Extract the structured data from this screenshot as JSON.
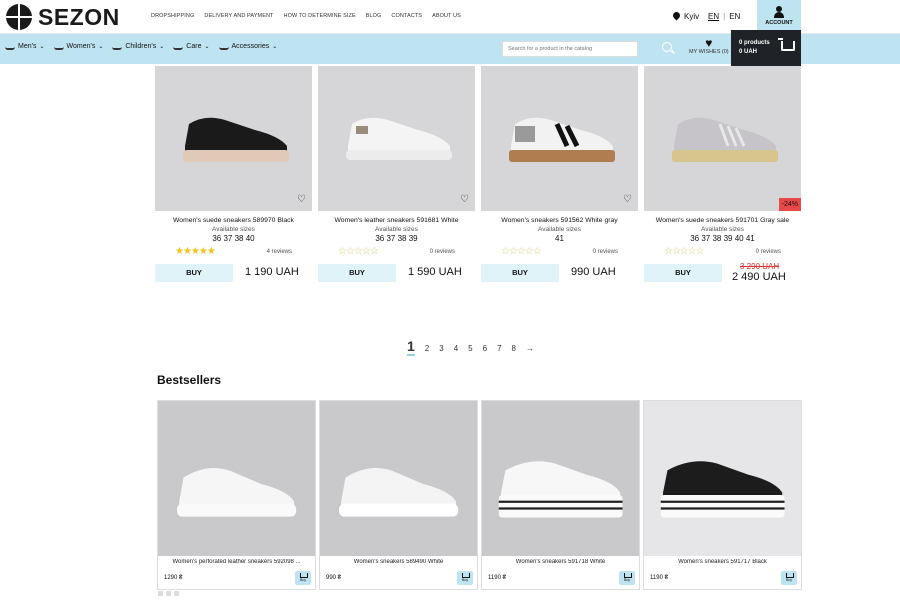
{
  "header": {
    "logo": "SEZON",
    "nav": [
      "DROPSHIPPING",
      "DELIVERY AND PAYMENT",
      "HOW TO DETERMINE SIZE",
      "BLOG",
      "CONTACTS",
      "ABOUT US"
    ],
    "city": "Kyiv",
    "lang_active": "EN",
    "lang_sep": "|",
    "lang_other": "EN",
    "account": "ACCOUNT"
  },
  "catbar": {
    "categories": [
      "Men's",
      "Women's",
      "Children's",
      "Care",
      "Accessories"
    ],
    "search_placeholder": "Search for a product in the catalog",
    "wishes": "MY WISHES (0)",
    "cart_products": "0 products",
    "cart_sum": "0 UAH"
  },
  "products": [
    {
      "name": "Women's suede sneakers 589970 Black",
      "avail": "Available sizes",
      "sizes": "36 37 38 40",
      "stars": "★★★★★",
      "reviews": "4 reviews",
      "buy": "BUY",
      "price": "1 190 UAH"
    },
    {
      "name": "Women's leather sneakers 591681 White",
      "avail": "Available sizes",
      "sizes": "36 37 38 39",
      "stars": "☆☆☆☆☆",
      "reviews": "0 reviews",
      "buy": "BUY",
      "price": "1 590 UAH"
    },
    {
      "name": "Women's sneakers 591562 White gray",
      "avail": "Available sizes",
      "sizes": "41",
      "stars": "☆☆☆☆☆",
      "reviews": "0 reviews",
      "buy": "BUY",
      "price": "990 UAH"
    },
    {
      "name": "Women's suede sneakers 591701 Gray sale",
      "avail": "Available sizes",
      "sizes": "36 37 38 39 40 41",
      "stars": "☆☆☆☆☆",
      "reviews": "0 reviews",
      "buy": "BUY",
      "old_price": "3 290 UAH",
      "price": "2 490 UAH",
      "discount": "-24%"
    }
  ],
  "pager": {
    "current": "1",
    "pages": [
      "2",
      "3",
      "4",
      "5",
      "6",
      "7",
      "8"
    ],
    "next": "→"
  },
  "bestsellers": {
    "title": "Bestsellers",
    "items": [
      {
        "name": "Women's perforated leather sneakers 592098 ...",
        "price": "1290 ₴",
        "buy": "Buy"
      },
      {
        "name": "Women's sneakers 589490 White",
        "price": "990 ₴",
        "buy": "Buy"
      },
      {
        "name": "Women's sneakers 591718 White",
        "price": "1190 ₴",
        "buy": "Buy"
      },
      {
        "name": "Women's sneakers 591717 Black",
        "price": "1190 ₴",
        "buy": "Buy"
      }
    ]
  },
  "colors": {
    "accent": "#bfe4f1",
    "buy_bg": "#dff3f8",
    "discount": "#e84848",
    "dark": "#1f2226"
  }
}
